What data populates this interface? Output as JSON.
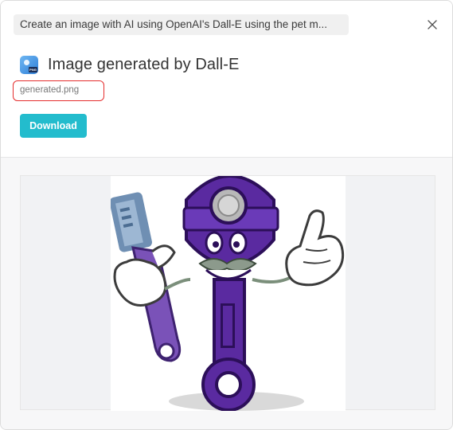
{
  "modal": {
    "breadcrumb": "Create an image with AI using OpenAI's Dall-E using the pet m...",
    "title": "Image generated by Dall-E",
    "filename": "generated.png",
    "download_label": "Download",
    "app_icon_tag": "PNG"
  },
  "icons": {
    "close": "close-icon",
    "app": "image-file-icon"
  },
  "colors": {
    "accent": "#23bccd",
    "highlight_border": "#e52d2d",
    "image_subject": "#5a2aa0"
  }
}
